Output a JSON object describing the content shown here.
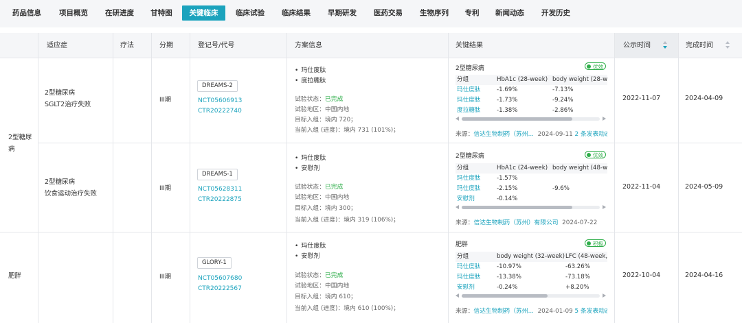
{
  "tabs": [
    "药品信息",
    "项目概览",
    "在研进度",
    "甘特图",
    "关键临床",
    "临床试验",
    "临床结果",
    "早期研发",
    "医药交易",
    "生物序列",
    "专利",
    "新闻动态",
    "开发历史"
  ],
  "active_tab": "关键临床",
  "columns": {
    "indication": "适应症",
    "therapy": "疗法",
    "phase": "分期",
    "reg_no": "登记号/代号",
    "plan": "方案信息",
    "results": "关键结果",
    "publish_date": "公示时间",
    "finish_date": "完成时间"
  },
  "groups": [
    {
      "indication": "2型糖尿病"
    },
    {
      "indication": "肥胖"
    }
  ],
  "trials": [
    {
      "sub_indication": [
        "2型糖尿病",
        "SGLT2治疗失败"
      ],
      "phase": "III期",
      "code": "DREAMS-2",
      "reg_nos": [
        "NCT05606913",
        "CTR20222740"
      ],
      "drugs": [
        "玛仕度肽",
        "度拉糖肽"
      ],
      "status_label": "试验状态：",
      "status": "已完成",
      "region": "试验地区：中国内地",
      "target": "目标入组：境内 720；",
      "enrolled": "当前入组 (进度)：境内 731 (101%)；",
      "result_title": "2型糖尿病",
      "result_tag": "优效",
      "table_head": [
        "分组",
        "HbA1c (28-week)",
        "body weight (28-we"
      ],
      "table_rows": [
        [
          "玛仕度肽",
          "-1.69%",
          "-7.13%"
        ],
        [
          "玛仕度肽",
          "-1.73%",
          "-9.24%"
        ],
        [
          "度拉糖肽",
          "-1.38%",
          "-2.86%"
        ]
      ],
      "source_label": "来源：",
      "source_link": "信达生物制药（苏州...",
      "source_date": "2024-09-11",
      "source_more": "2 条发表动态",
      "publish_date": "2022-11-07",
      "finish_date": "2024-04-09"
    },
    {
      "sub_indication": [
        "2型糖尿病",
        "饮食运动治疗失败"
      ],
      "phase": "III期",
      "code": "DREAMS-1",
      "reg_nos": [
        "NCT05628311",
        "CTR20222875"
      ],
      "drugs": [
        "玛仕度肽",
        "安慰剂"
      ],
      "status_label": "试验状态：",
      "status": "已完成",
      "region": "试验地区：中国内地",
      "target": "目标入组：境内 300；",
      "enrolled": "当前入组 (进度)：境内 319 (106%)；",
      "result_title": "2型糖尿病",
      "result_tag": "优效",
      "table_head": [
        "分组",
        "HbA1c (24-week)",
        "body weight (48-wee"
      ],
      "table_rows": [
        [
          "玛仕度肽",
          "-1.57%",
          ""
        ],
        [
          "玛仕度肽",
          "-2.15%",
          "-9.6%"
        ],
        [
          "安慰剂",
          "-0.14%",
          ""
        ]
      ],
      "source_label": "来源：",
      "source_link": "信达生物制药（苏州）有限公司",
      "source_date": "2024-07-22",
      "source_more": "",
      "publish_date": "2022-11-04",
      "finish_date": "2024-05-09"
    },
    {
      "sub_indication": [],
      "phase": "III期",
      "code": "GLORY-1",
      "reg_nos": [
        "NCT05607680",
        "CTR20222567"
      ],
      "drugs": [
        "玛仕度肽",
        "安慰剂"
      ],
      "status_label": "试验状态：",
      "status": "已完成",
      "region": "试验地区：中国内地",
      "target": "目标入组：境内 610；",
      "enrolled": "当前入组 (进度)：境内 610 (100%)；",
      "result_title": "肥胖",
      "result_tag": "积极",
      "table_head": [
        "分组",
        "body weight (32-week)",
        "LFC (48-week,"
      ],
      "table_rows": [
        [
          "玛仕度肽",
          "-10.97%",
          "-63.26%"
        ],
        [
          "玛仕度肽",
          "-13.38%",
          "-73.18%"
        ],
        [
          "安慰剂",
          "-0.24%",
          "+8.20%"
        ]
      ],
      "source_label": "来源：",
      "source_link": "信达生物制药（苏州...",
      "source_date": "2024-01-09",
      "source_more": "5 条发表动态",
      "publish_date": "2022-10-04",
      "finish_date": "2024-04-16"
    }
  ],
  "colors": {
    "accent": "#1ba3bd",
    "success": "#2fae4a",
    "header_bg": "#f5f6f8",
    "border": "#e4e6ea"
  }
}
